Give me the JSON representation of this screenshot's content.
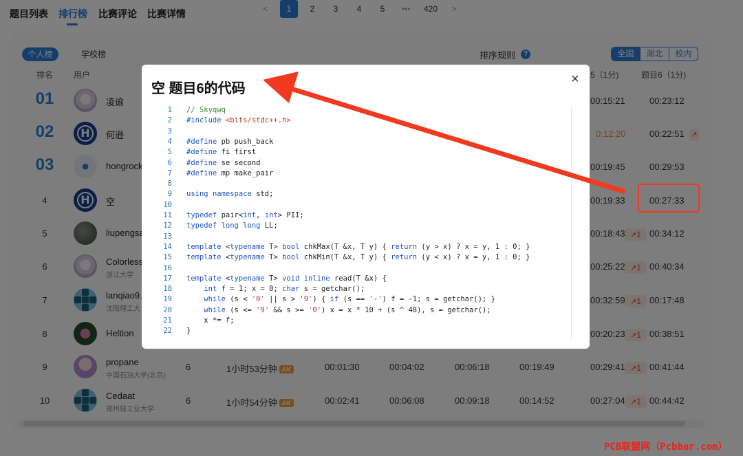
{
  "nav": {
    "tabs": [
      "题目列表",
      "排行榜",
      "比赛评论",
      "比赛详情"
    ],
    "active": "排行榜"
  },
  "ranking": {
    "scope_tabs": [
      "个人榜",
      "学校榜"
    ],
    "sort_rule": "排序规则",
    "help_icon": "?",
    "region_tabs": [
      "全国",
      "湖北",
      "校内"
    ],
    "headers": {
      "rank": "排名",
      "user": "用户",
      "p5": "5（1分)",
      "p6": "题目6（1分)"
    },
    "rows": [
      {
        "rank": "01",
        "name": "凌谕",
        "school": "",
        "solved": "",
        "penalty": "",
        "t1": "",
        "t2": "",
        "t3": "",
        "t4": "",
        "t5": "00:15:21",
        "t6": "00:23:12"
      },
      {
        "rank": "02",
        "name": "何逊",
        "school": "",
        "solved": "",
        "penalty": "",
        "t1": "",
        "t2": "",
        "t3": "",
        "t4": "",
        "t5": "0:12:20",
        "t6": "00:22:51"
      },
      {
        "rank": "03",
        "name": "hongrock",
        "school": "",
        "solved": "",
        "penalty": "",
        "t1": "",
        "t2": "",
        "t3": "",
        "t4": "",
        "t5": "00:19:45",
        "t6": "00:29:53"
      },
      {
        "rank": "4",
        "name": "空",
        "school": "",
        "solved": "",
        "penalty": "",
        "t1": "",
        "t2": "",
        "t3": "",
        "t4": "",
        "t5": "00:19:33",
        "t6": "00:27:33"
      },
      {
        "rank": "5",
        "name": "liupengsa",
        "school": "",
        "solved": "",
        "penalty": "",
        "t1": "",
        "t2": "",
        "t3": "",
        "t4": "",
        "t5": "00:18:43",
        "badge": "1",
        "t6": "00:34:12"
      },
      {
        "rank": "6",
        "name": "Colorless",
        "school": "浙江大学",
        "solved": "",
        "penalty": "",
        "t1": "",
        "t2": "",
        "t3": "",
        "t4": "",
        "t5": "00:25:22",
        "badge": "1",
        "t6": "00:40:34"
      },
      {
        "rank": "7",
        "name": "lanqiao9.",
        "school": "沈阳理工大",
        "solved": "",
        "penalty": "",
        "t1": "",
        "t2": "",
        "t3": "",
        "t4": "",
        "t5": "00:32:59",
        "badge": "1",
        "t6": "00:17:48"
      },
      {
        "rank": "8",
        "name": "Heltion",
        "school": "",
        "solved": "",
        "penalty": "",
        "t1": "",
        "t2": "",
        "t3": "",
        "t4": "",
        "t5": "00:20:23",
        "badge": "1",
        "t6": "00:38:51"
      },
      {
        "rank": "9",
        "name": "propane",
        "school": "中国石油大学(北京)",
        "solved": "6",
        "penalty": "1小时53分钟",
        "ak": "AK",
        "t1": "00:01:30",
        "t2": "00:04:02",
        "t3": "00:06:18",
        "t4": "00:19:49",
        "t5": "00:29:41",
        "badge": "1",
        "t6": "00:41:44"
      },
      {
        "rank": "10",
        "name": "Cedaat",
        "school": "郑州轻工业大学",
        "solved": "6",
        "penalty": "1小时54分钟",
        "ak": "AK",
        "t1": "00:02:41",
        "t2": "00:06:08",
        "t3": "00:09:18",
        "t4": "00:14:52",
        "t5": "00:27:04",
        "badge": "1",
        "t6": "00:44:42"
      }
    ]
  },
  "pagination": {
    "prev": "<",
    "pages": [
      "1",
      "2",
      "3",
      "4",
      "5"
    ],
    "ellipsis": "•••",
    "last": "420",
    "next": ">"
  },
  "modal": {
    "title": "空 题目6的代码",
    "close": "×",
    "code_lines": [
      "// Skyqwq",
      "#include <bits/stdc++.h>",
      "",
      "#define pb push_back",
      "#define fi first",
      "#define se second",
      "#define mp make_pair",
      "",
      "using namespace std;",
      "",
      "typedef pair<int, int> PII;",
      "typedef long long LL;",
      "",
      "template <typename T> bool chkMax(T &x, T y) { return (y > x) ? x = y, 1 : 0; }",
      "template <typename T> bool chkMin(T &x, T y) { return (y < x) ? x = y, 1 : 0; }",
      "",
      "template <typename T> void inline read(T &x) {",
      "    int f = 1; x = 0; char s = getchar();",
      "    while (s < '0' || s > '9') { if (s == '-') f = -1; s = getchar(); }",
      "    while (s <= '9' && s >= '0') x = x * 10 + (s ^ 48), s = getchar();",
      "    x *= f;",
      "}"
    ]
  },
  "watermark": "PCB联盟网（Pcbbar.com）",
  "colors": {
    "accent": "#2a7fd4",
    "annotation": "#f03a1f",
    "ak": "#f39a3b"
  }
}
